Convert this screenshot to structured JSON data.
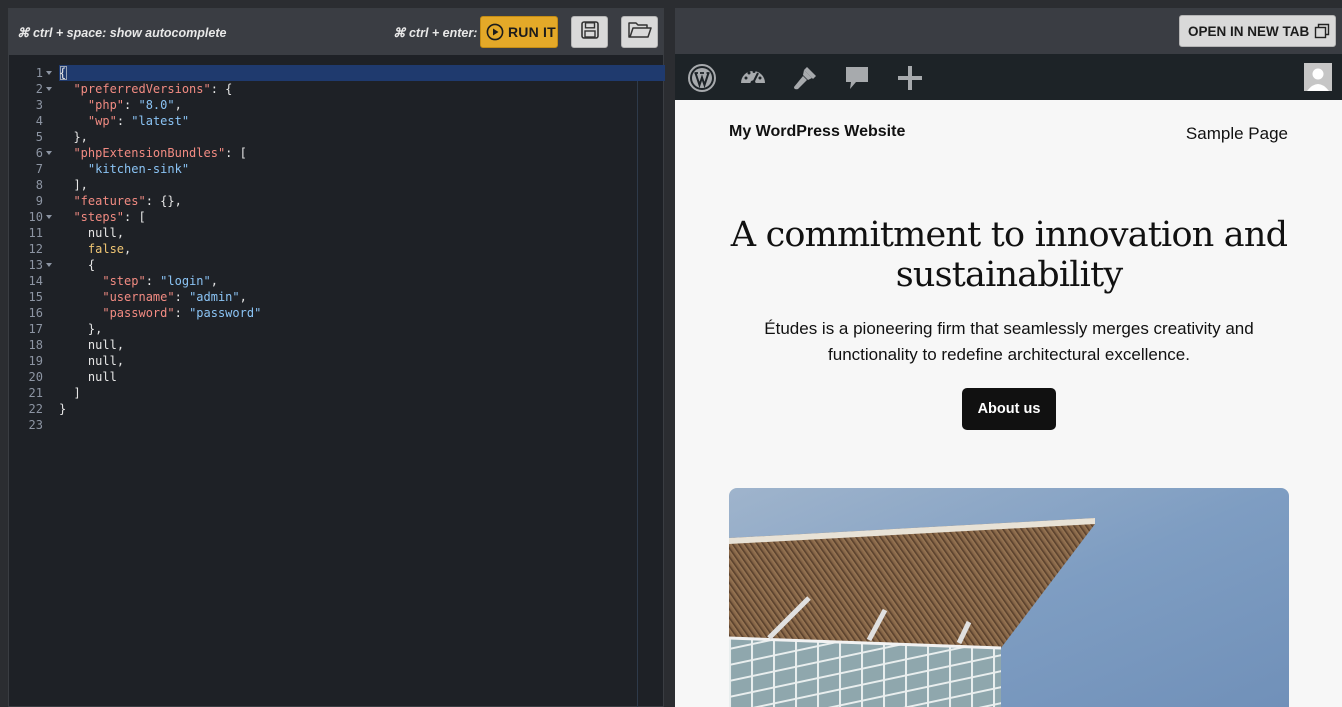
{
  "editor": {
    "hint_autocomplete": "⌘ ctrl + space: show autocomplete",
    "hint_run": "⌘ ctrl + enter:",
    "run_button_label": "RUN IT",
    "run_icon": "play-circle-icon",
    "save_icon": "floppy-disk-icon",
    "open_icon": "folder-open-icon",
    "line_numbers": [
      "1",
      "2",
      "3",
      "4",
      "5",
      "6",
      "7",
      "8",
      "9",
      "10",
      "11",
      "12",
      "13",
      "14",
      "15",
      "16",
      "17",
      "18",
      "19",
      "20",
      "21",
      "22",
      "23"
    ],
    "foldable_lines": [
      1,
      2,
      6,
      10,
      13
    ],
    "code_lines": [
      [
        [
          "p",
          "{"
        ]
      ],
      [
        [
          "p",
          "  "
        ],
        [
          "k",
          "\"preferredVersions\""
        ],
        [
          "p",
          ": {"
        ]
      ],
      [
        [
          "p",
          "    "
        ],
        [
          "k",
          "\"php\""
        ],
        [
          "p",
          ": "
        ],
        [
          "s",
          "\"8.0\""
        ],
        [
          "p",
          ","
        ]
      ],
      [
        [
          "p",
          "    "
        ],
        [
          "k",
          "\"wp\""
        ],
        [
          "p",
          ": "
        ],
        [
          "s",
          "\"latest\""
        ]
      ],
      [
        [
          "p",
          "  },"
        ]
      ],
      [
        [
          "p",
          "  "
        ],
        [
          "k",
          "\"phpExtensionBundles\""
        ],
        [
          "p",
          ": ["
        ]
      ],
      [
        [
          "p",
          "    "
        ],
        [
          "s",
          "\"kitchen-sink\""
        ]
      ],
      [
        [
          "p",
          "  ],"
        ]
      ],
      [
        [
          "p",
          "  "
        ],
        [
          "k",
          "\"features\""
        ],
        [
          "p",
          ": {},"
        ]
      ],
      [
        [
          "p",
          "  "
        ],
        [
          "k",
          "\"steps\""
        ],
        [
          "p",
          ": ["
        ]
      ],
      [
        [
          "p",
          "    "
        ],
        [
          "n",
          "null"
        ],
        [
          "p",
          ","
        ]
      ],
      [
        [
          "p",
          "    "
        ],
        [
          "b",
          "false"
        ],
        [
          "p",
          ","
        ]
      ],
      [
        [
          "p",
          "    {"
        ]
      ],
      [
        [
          "p",
          "      "
        ],
        [
          "k",
          "\"step\""
        ],
        [
          "p",
          ": "
        ],
        [
          "s",
          "\"login\""
        ],
        [
          "p",
          ","
        ]
      ],
      [
        [
          "p",
          "      "
        ],
        [
          "k",
          "\"username\""
        ],
        [
          "p",
          ": "
        ],
        [
          "s",
          "\"admin\""
        ],
        [
          "p",
          ","
        ]
      ],
      [
        [
          "p",
          "      "
        ],
        [
          "k",
          "\"password\""
        ],
        [
          "p",
          ": "
        ],
        [
          "s",
          "\"password\""
        ]
      ],
      [
        [
          "p",
          "    },"
        ]
      ],
      [
        [
          "p",
          "    "
        ],
        [
          "n",
          "null"
        ],
        [
          "p",
          ","
        ]
      ],
      [
        [
          "p",
          "    "
        ],
        [
          "n",
          "null"
        ],
        [
          "p",
          ","
        ]
      ],
      [
        [
          "p",
          "    "
        ],
        [
          "n",
          "null"
        ]
      ],
      [
        [
          "p",
          "  ]"
        ]
      ],
      [
        [
          "p",
          "}"
        ]
      ],
      [
        [
          "p",
          ""
        ]
      ]
    ],
    "active_line": 1
  },
  "preview": {
    "open_new_tab_label": "OPEN IN NEW TAB",
    "open_new_tab_icon": "external-window-icon",
    "admin_bar_icons": [
      "wordpress-logo-icon",
      "dashboard-icon",
      "customize-brush-icon",
      "comments-icon",
      "new-content-plus-icon"
    ],
    "avatar_icon": "user-avatar-icon",
    "site_title": "My WordPress Website",
    "nav_link": "Sample Page",
    "hero_heading": "A commitment to innovation and sustainability",
    "hero_text": "Études is a pioneering firm that seamlessly merges creativity and functionality to redefine architectural excellence.",
    "cta_label": "About us"
  },
  "colors": {
    "accent_run": "#e4a928",
    "editor_bg": "#1e2126",
    "toolbar_bg": "#3a3d43",
    "admin_bar_bg": "#1d2327",
    "json_key": "#f28b82",
    "json_string": "#8bc4f5",
    "json_bool": "#f0c674"
  }
}
